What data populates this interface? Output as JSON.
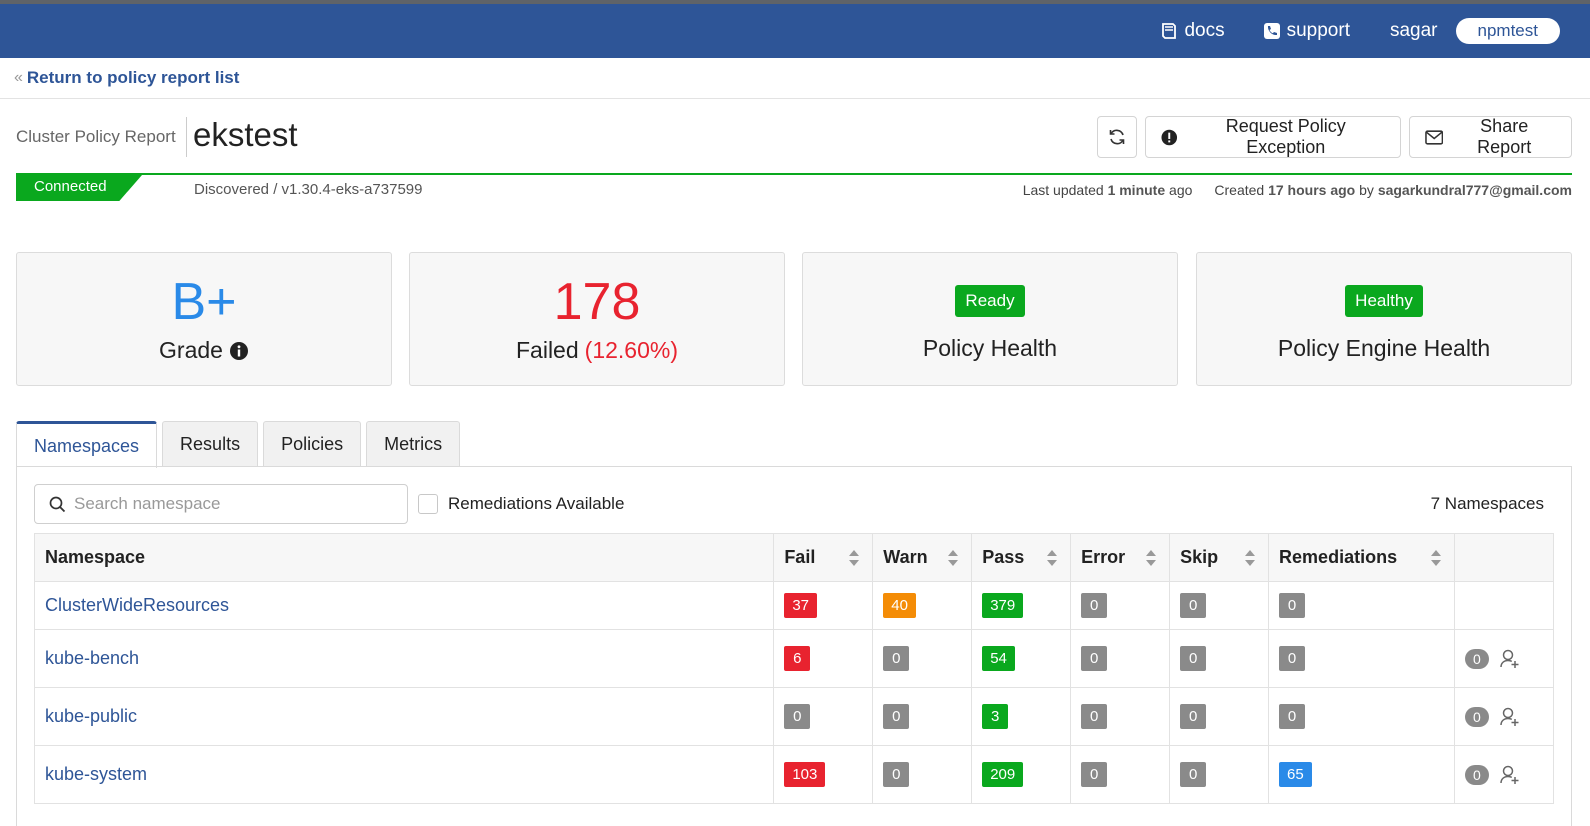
{
  "topbar": {
    "docs_label": "docs",
    "support_label": "support",
    "user": "sagar",
    "org": "npmtest"
  },
  "breadcrumb": {
    "back_label": "Return to policy report list"
  },
  "header": {
    "subtitle": "Cluster Policy Report",
    "title": "ekstest",
    "request_exception_label": "Request Policy Exception",
    "share_label": "Share Report"
  },
  "status": {
    "connection": "Connected",
    "discovered": "Discovered / v1.30.4-eks-a737599",
    "last_updated_prefix": "Last updated",
    "last_updated_value": "1 minute",
    "last_updated_suffix": "ago",
    "created_prefix": "Created",
    "created_value": "17 hours ago",
    "created_by": "by",
    "created_email": "sagarkundral777@gmail.com"
  },
  "cards": {
    "grade_value": "B+",
    "grade_label": "Grade",
    "failed_value": "178",
    "failed_label": "Failed",
    "failed_pct": "(12.60%)",
    "policy_health_badge": "Ready",
    "policy_health_label": "Policy Health",
    "engine_health_badge": "Healthy",
    "engine_health_label": "Policy Engine Health"
  },
  "tabs": [
    "Namespaces",
    "Results",
    "Policies",
    "Metrics"
  ],
  "filters": {
    "search_placeholder": "Search namespace",
    "remediations_label": "Remediations Available",
    "namespace_count": "7 Namespaces"
  },
  "table": {
    "columns": [
      "Namespace",
      "Fail",
      "Warn",
      "Pass",
      "Error",
      "Skip",
      "Remediations"
    ],
    "rows": [
      {
        "name": "ClusterWideResources",
        "fail": "37",
        "warn": "40",
        "pass": "379",
        "error": "0",
        "skip": "0",
        "remediations": "0",
        "action_count": ""
      },
      {
        "name": "kube-bench",
        "fail": "6",
        "warn": "0",
        "pass": "54",
        "error": "0",
        "skip": "0",
        "remediations": "0",
        "action_count": "0"
      },
      {
        "name": "kube-public",
        "fail": "0",
        "warn": "0",
        "pass": "3",
        "error": "0",
        "skip": "0",
        "remediations": "0",
        "action_count": "0"
      },
      {
        "name": "kube-system",
        "fail": "103",
        "warn": "0",
        "pass": "209",
        "error": "0",
        "skip": "0",
        "remediations": "65",
        "action_count": "0"
      }
    ]
  },
  "colors": {
    "brand": "#2e5597",
    "fail": "#e8232f",
    "warn": "#f48c06",
    "pass": "#0aa81e",
    "neutral": "#8a8a8a",
    "info": "#2a8ae8"
  },
  "icons": [
    "book-icon",
    "phone-icon",
    "double-chevron-left-icon",
    "refresh-icon",
    "exclamation-circle-icon",
    "envelope-icon",
    "info-circle-icon",
    "search-icon",
    "sort-icon",
    "add-user-icon"
  ]
}
